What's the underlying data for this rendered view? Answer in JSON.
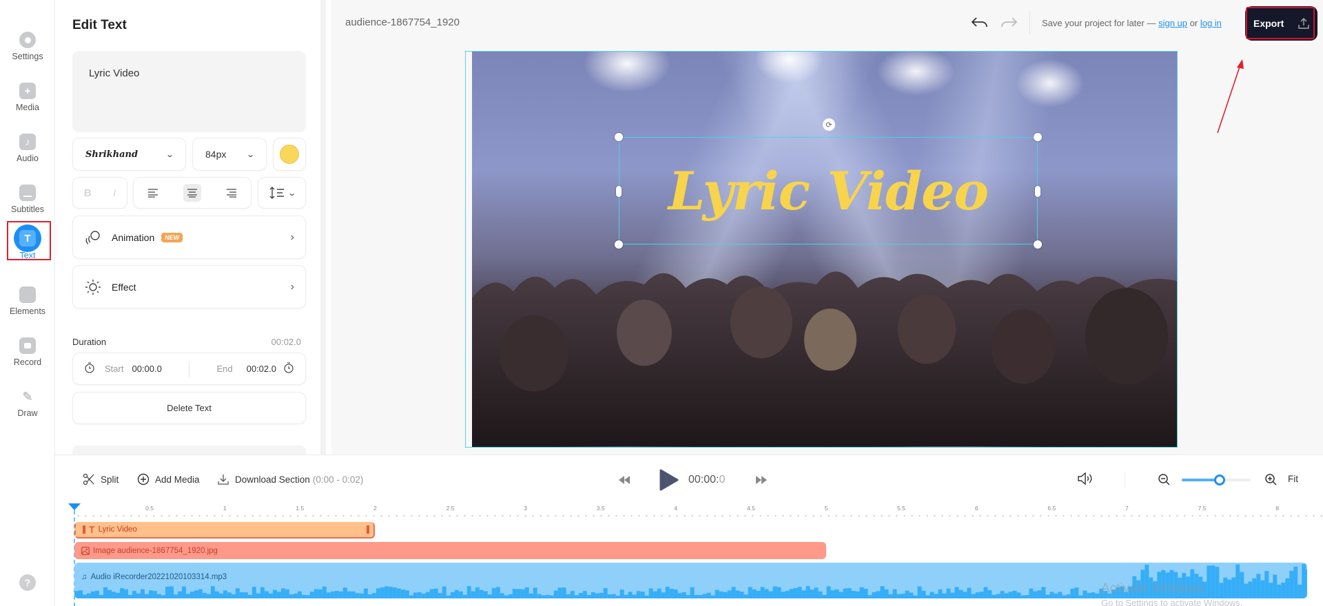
{
  "sidebar": {
    "items": [
      {
        "label": "Settings",
        "icon": "gear-icon"
      },
      {
        "label": "Media",
        "icon": "plus-icon"
      },
      {
        "label": "Audio",
        "icon": "music-note-icon"
      },
      {
        "label": "Subtitles",
        "icon": "subtitles-icon"
      },
      {
        "label": "Text",
        "icon": "text-icon",
        "active": true
      },
      {
        "label": "Elements",
        "icon": "sticker-icon"
      },
      {
        "label": "Record",
        "icon": "camera-icon"
      },
      {
        "label": "Draw",
        "icon": "pencil-icon"
      }
    ],
    "help_glyph": "?"
  },
  "panel": {
    "title": "Edit Text",
    "text_value": "Lyric Video",
    "font": "Shrikhand",
    "font_size": "84px",
    "text_color": "#f9d75a",
    "bold_label": "B",
    "italic_label": "I",
    "alignment_selected": "center",
    "animation_label": "Animation",
    "new_badge": "NEW",
    "effect_label": "Effect",
    "duration_label": "Duration",
    "duration_value": "00:02.0",
    "start_label": "Start",
    "start_value": "00:00.0",
    "end_label": "End",
    "end_value": "00:02.0",
    "delete_label": "Delete Text"
  },
  "header": {
    "project_name": "audience-1867754_1920",
    "save_prefix": "Save your project for later —",
    "sign_up": "sign up",
    "or": "or",
    "log_in": "log in",
    "export_label": "Export"
  },
  "canvas": {
    "overlay_text": "Lyric Video",
    "overlay_color": "#f7d44c"
  },
  "timeline": {
    "split_label": "Split",
    "add_media_label": "Add Media",
    "download_label": "Download Section",
    "download_range": "(0:00 - 0:02)",
    "timecode_main": "00:00:",
    "timecode_frac": "0",
    "fit_label": "Fit",
    "zoom_level": 0.55,
    "ruler_ticks": [
      "0.5",
      "1",
      "1.5",
      "2",
      "2.5",
      "3",
      "3.5",
      "4",
      "4.5",
      "5",
      "5.5",
      "6",
      "6.5",
      "7",
      "7.5",
      "8"
    ],
    "tracks": [
      {
        "type": "text",
        "label": "Lyric Video",
        "start": 0,
        "end": 2
      },
      {
        "type": "image",
        "label": "Image audience-1867754_1920.jpg",
        "start": 0,
        "end": 5
      },
      {
        "type": "audio",
        "label": "Audio iRecorder20221020103314.mp3",
        "start": 0,
        "end": 8.2
      }
    ]
  },
  "watermark": {
    "line1": "Activate Windows",
    "line2": "Go to Settings to activate Windows."
  }
}
